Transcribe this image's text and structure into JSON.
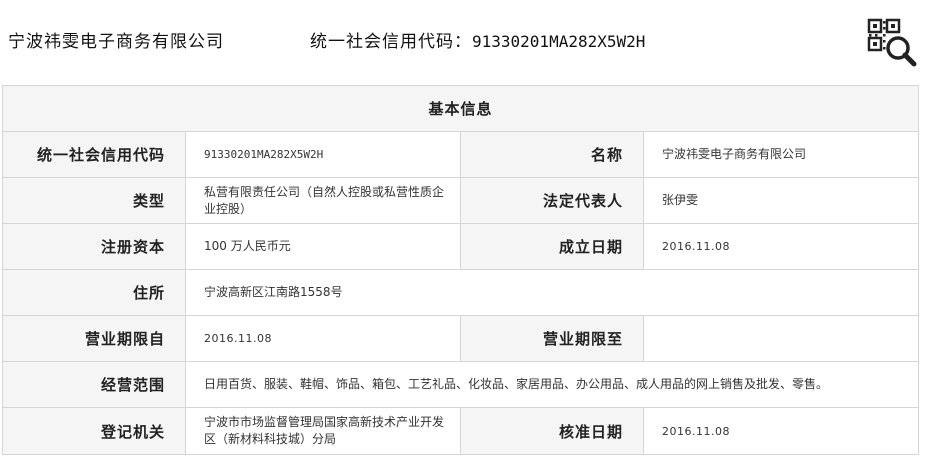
{
  "header": {
    "company_name": "宁波祎雯电子商务有限公司",
    "credit_code_label": "统一社会信用代码：",
    "credit_code_value": "91330201MA282X5W2H",
    "qr_search_icon": "qr-search-icon"
  },
  "table": {
    "title": "基本信息",
    "rows": [
      {
        "k1": "统一社会信用代码",
        "v1": "91330201MA282X5W2H",
        "k2": "名称",
        "v2": "宁波祎雯电子商务有限公司"
      },
      {
        "k1": "类型",
        "v1": "私营有限责任公司（自然人控股或私营性质企业控股）",
        "k2": "法定代表人",
        "v2": "张伊雯"
      },
      {
        "k1": "注册资本",
        "v1": "100 万人民币元",
        "k2": "成立日期",
        "v2": "2016.11.08"
      },
      {
        "k1": "住所",
        "v1": "宁波高新区江南路1558号"
      },
      {
        "k1": "营业期限自",
        "v1": "2016.11.08",
        "k2": "营业期限至",
        "v2": ""
      },
      {
        "k1": "经营范围",
        "v1": "日用百货、服装、鞋帽、饰品、箱包、工艺礼品、化妆品、家居用品、办公用品、成人用品的网上销售及批发、零售。"
      },
      {
        "k1": "登记机关",
        "v1": "宁波市市场监督管理局国家高新技术产业开发区（新材料科技城）分局",
        "k2": "核准日期",
        "v2": "2016.11.08"
      }
    ]
  }
}
